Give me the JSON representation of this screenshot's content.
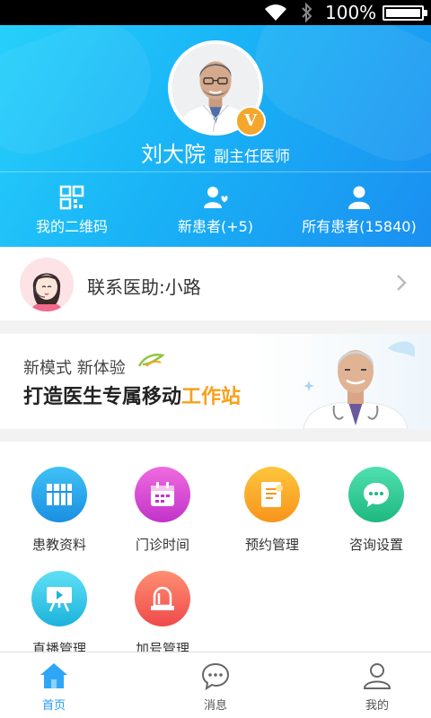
{
  "status_bar": {
    "battery_text": "100%"
  },
  "profile": {
    "name": "刘大院",
    "title": "副主任医师",
    "badge": "V"
  },
  "quick_actions": [
    {
      "label": "我的二维码",
      "icon": "qr-code-icon"
    },
    {
      "label": "新患者(+5)",
      "icon": "new-patient-icon"
    },
    {
      "label": "所有患者(15840)",
      "icon": "all-patients-icon"
    }
  ],
  "assistant": {
    "label": "联系医助:小路",
    "icon": "assistant-avatar"
  },
  "banner": {
    "line1": "新模式 新体验",
    "line2_prefix": "打造医生专属移动",
    "line2_highlight": "工作站"
  },
  "grid": [
    {
      "label": "患教资料",
      "icon": "books-icon",
      "color": "#1ea3e8"
    },
    {
      "label": "门诊时间",
      "icon": "calendar-icon",
      "color": "#d845d6"
    },
    {
      "label": "预约管理",
      "icon": "appointment-icon",
      "color": "#f7a21c"
    },
    {
      "label": "咨询设置",
      "icon": "chat-bubble-icon",
      "color": "#28c990"
    },
    {
      "label": "直播管理",
      "icon": "live-board-icon",
      "color": "#25c5e6"
    },
    {
      "label": "加号管理",
      "icon": "alarm-light-icon",
      "color": "#f2594e"
    }
  ],
  "bottom_nav": [
    {
      "label": "首页",
      "icon": "home-icon",
      "active": true
    },
    {
      "label": "消息",
      "icon": "message-icon",
      "active": false
    },
    {
      "label": "我的",
      "icon": "profile-icon",
      "active": false
    }
  ],
  "colors": {
    "header_start": "#26d0fb",
    "header_end": "#1a8ff1",
    "accent_orange": "#f7a11a",
    "active_tab": "#1e9bf5"
  }
}
